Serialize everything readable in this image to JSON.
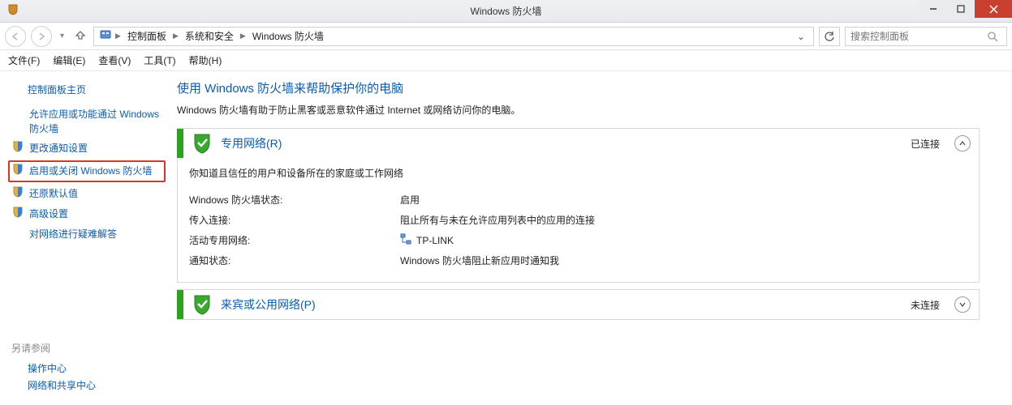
{
  "window": {
    "title": "Windows 防火墙"
  },
  "breadcrumb": {
    "root_icon": "control-panel",
    "items": [
      "控制面板",
      "系统和安全",
      "Windows 防火墙"
    ]
  },
  "search": {
    "placeholder": "搜索控制面板"
  },
  "menu": {
    "file": "文件(F)",
    "edit": "编辑(E)",
    "view": "查看(V)",
    "tools": "工具(T)",
    "help": "帮助(H)"
  },
  "sidebar": {
    "home": "控制面板主页",
    "allow": "允许应用或功能通过 Windows 防火墙",
    "notify": "更改通知设置",
    "toggle": "启用或关闭 Windows 防火墙",
    "restore": "还原默认值",
    "advanced": "高级设置",
    "troubleshoot": "对网络进行疑难解答",
    "seealso_title": "另请参阅",
    "action_center": "操作中心",
    "network_center": "网络和共享中心"
  },
  "content": {
    "heading": "使用 Windows 防火墙来帮助保护你的电脑",
    "desc": "Windows 防火墙有助于防止黑客或恶意软件通过 Internet 或网络访问你的电脑。"
  },
  "private_network": {
    "title": "专用网络(R)",
    "status": "已连接",
    "sub": "你知道且信任的用户和设备所在的家庭或工作网络",
    "rows": {
      "state_k": "Windows 防火墙状态:",
      "state_v": "启用",
      "incoming_k": "传入连接:",
      "incoming_v": "阻止所有与未在允许应用列表中的应用的连接",
      "active_k": "活动专用网络:",
      "active_v": "TP-LINK",
      "notify_k": "通知状态:",
      "notify_v": "Windows 防火墙阻止新应用时通知我"
    }
  },
  "public_network": {
    "title": "来宾或公用网络(P)",
    "status": "未连接"
  }
}
